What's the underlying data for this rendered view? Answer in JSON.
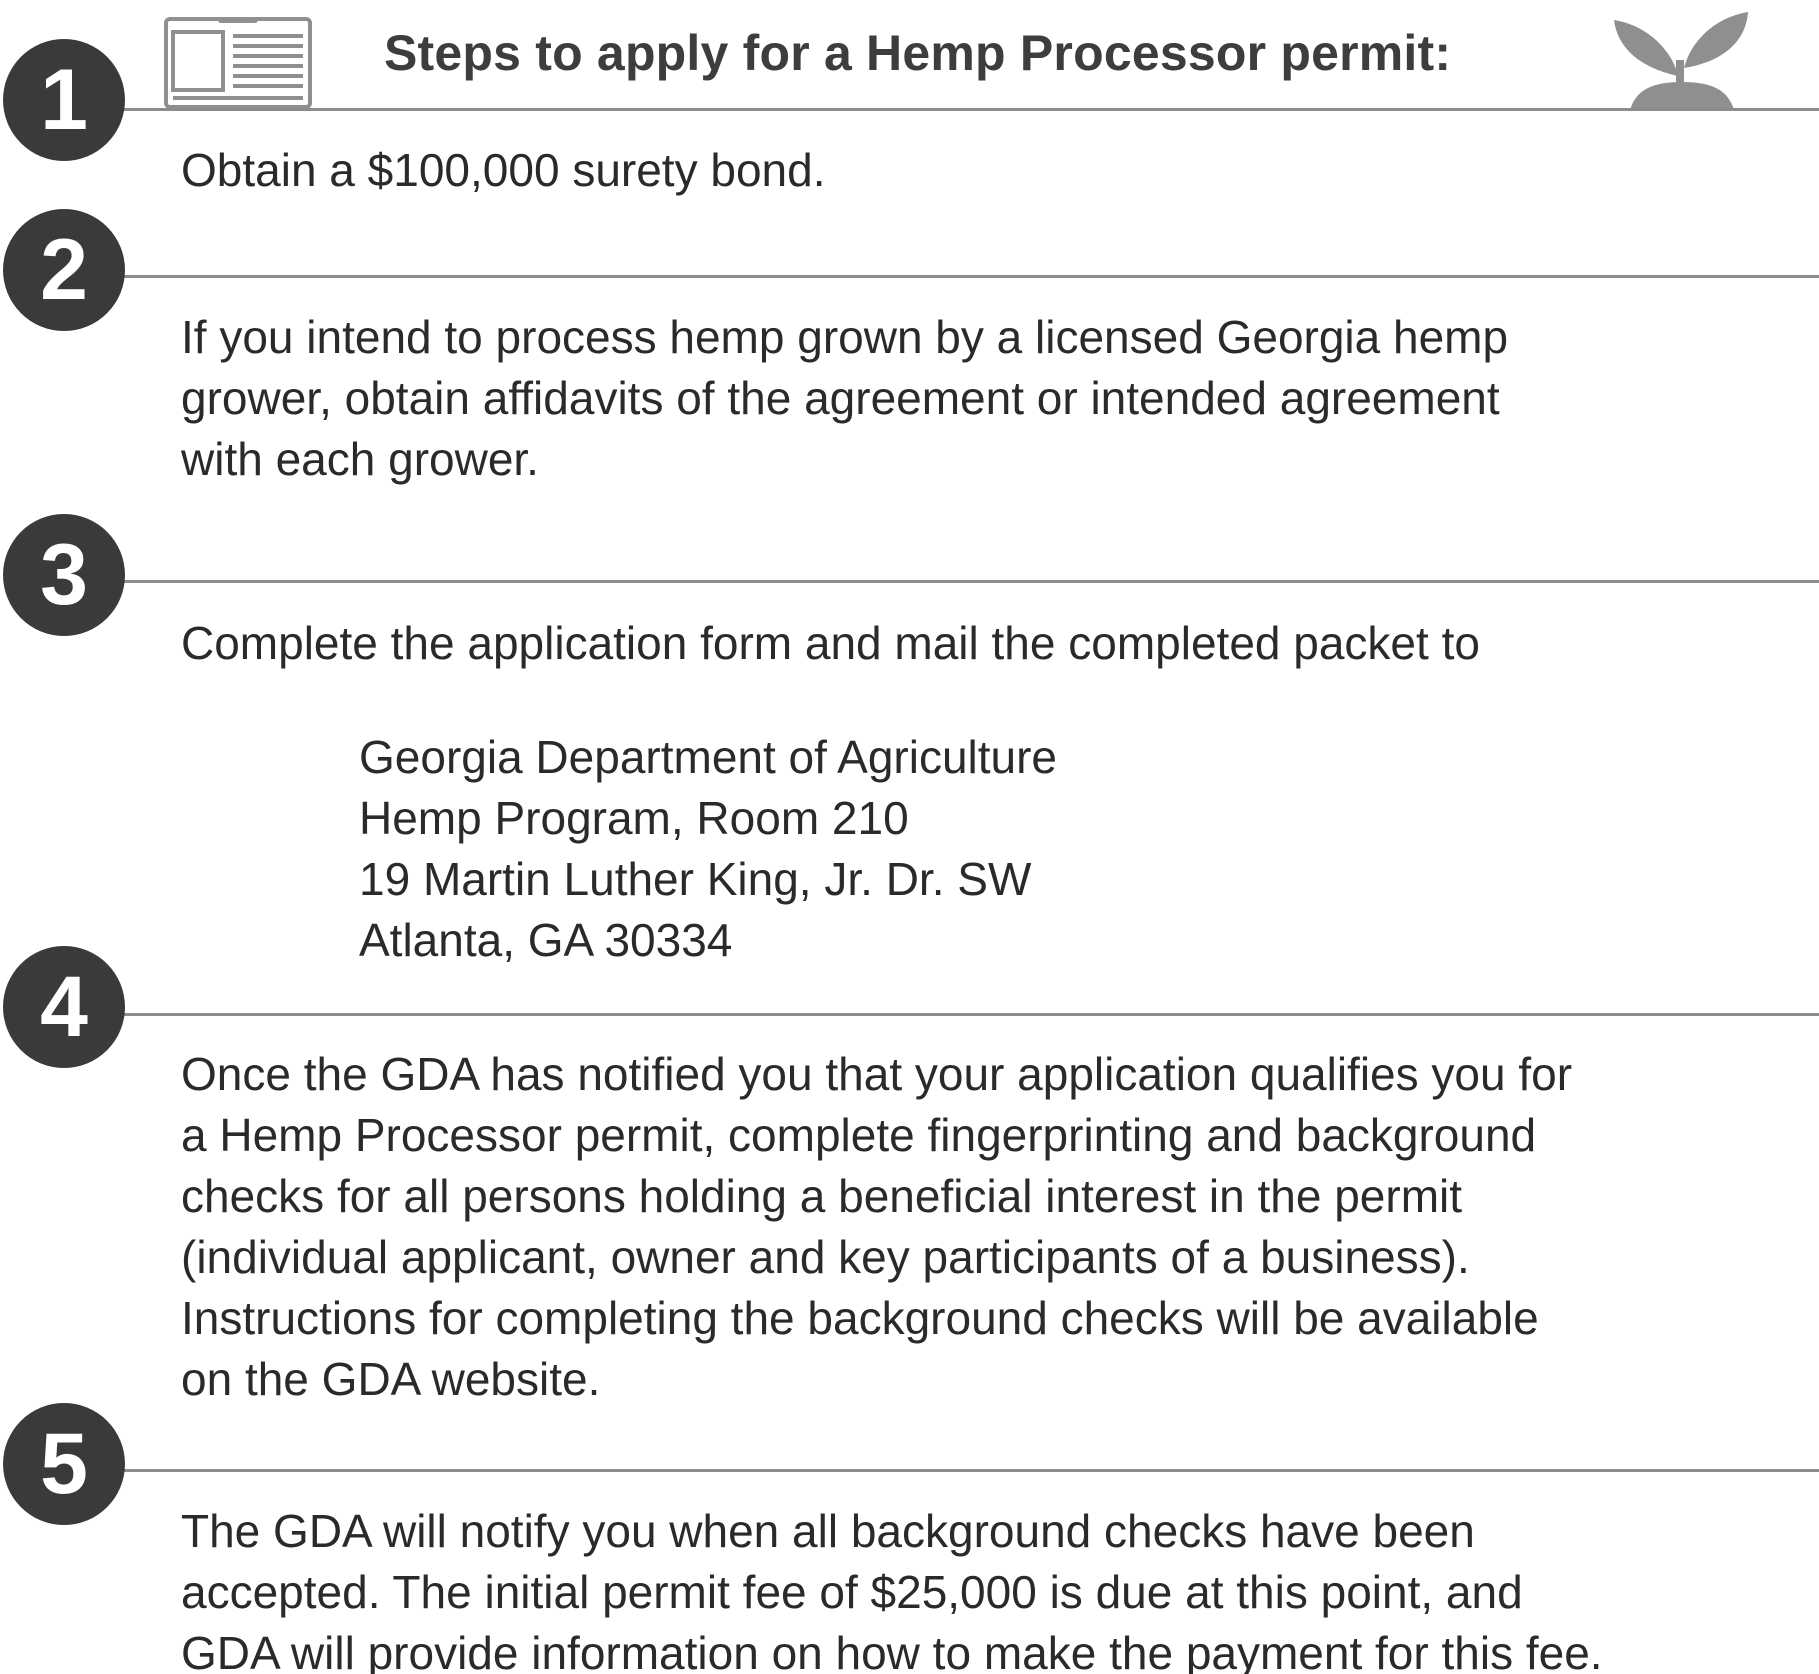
{
  "header": {
    "title": "Steps to apply for a Hemp Processor permit:",
    "left_icon": "document-icon",
    "right_icon": "sprout-icon"
  },
  "colors": {
    "circle": "#3a3a3a",
    "rule": "#8c8c8c",
    "icon": "#8f8f8f",
    "text": "#2a2a2a"
  },
  "steps": [
    {
      "number": "1",
      "lines": [
        "Obtain a $100,000 surety bond."
      ]
    },
    {
      "number": "2",
      "lines": [
        "If you intend to process hemp grown by a licensed Georgia hemp",
        "grower, obtain affidavits of the agreement or intended agreement",
        "with each grower."
      ]
    },
    {
      "number": "3",
      "lines": [
        "Complete the application form and mail the completed packet to"
      ],
      "address": [
        "Georgia Department of Agriculture",
        "Hemp Program, Room 210",
        "19 Martin Luther King, Jr. Dr. SW",
        "Atlanta, GA 30334"
      ]
    },
    {
      "number": "4",
      "lines": [
        "Once the GDA has notified you that your application qualifies you for",
        "a Hemp Processor permit, complete fingerprinting and background",
        "checks for all persons holding a beneficial interest in the permit",
        "(individual applicant, owner and key participants of a business).",
        "Instructions for completing the background checks will be available",
        "on the GDA website."
      ]
    },
    {
      "number": "5",
      "lines": [
        "The GDA will notify you when all background checks have been",
        "accepted.  The initial permit fee of $25,000 is due at this point, and",
        "GDA will provide information on how to make the payment for this fee."
      ]
    }
  ]
}
